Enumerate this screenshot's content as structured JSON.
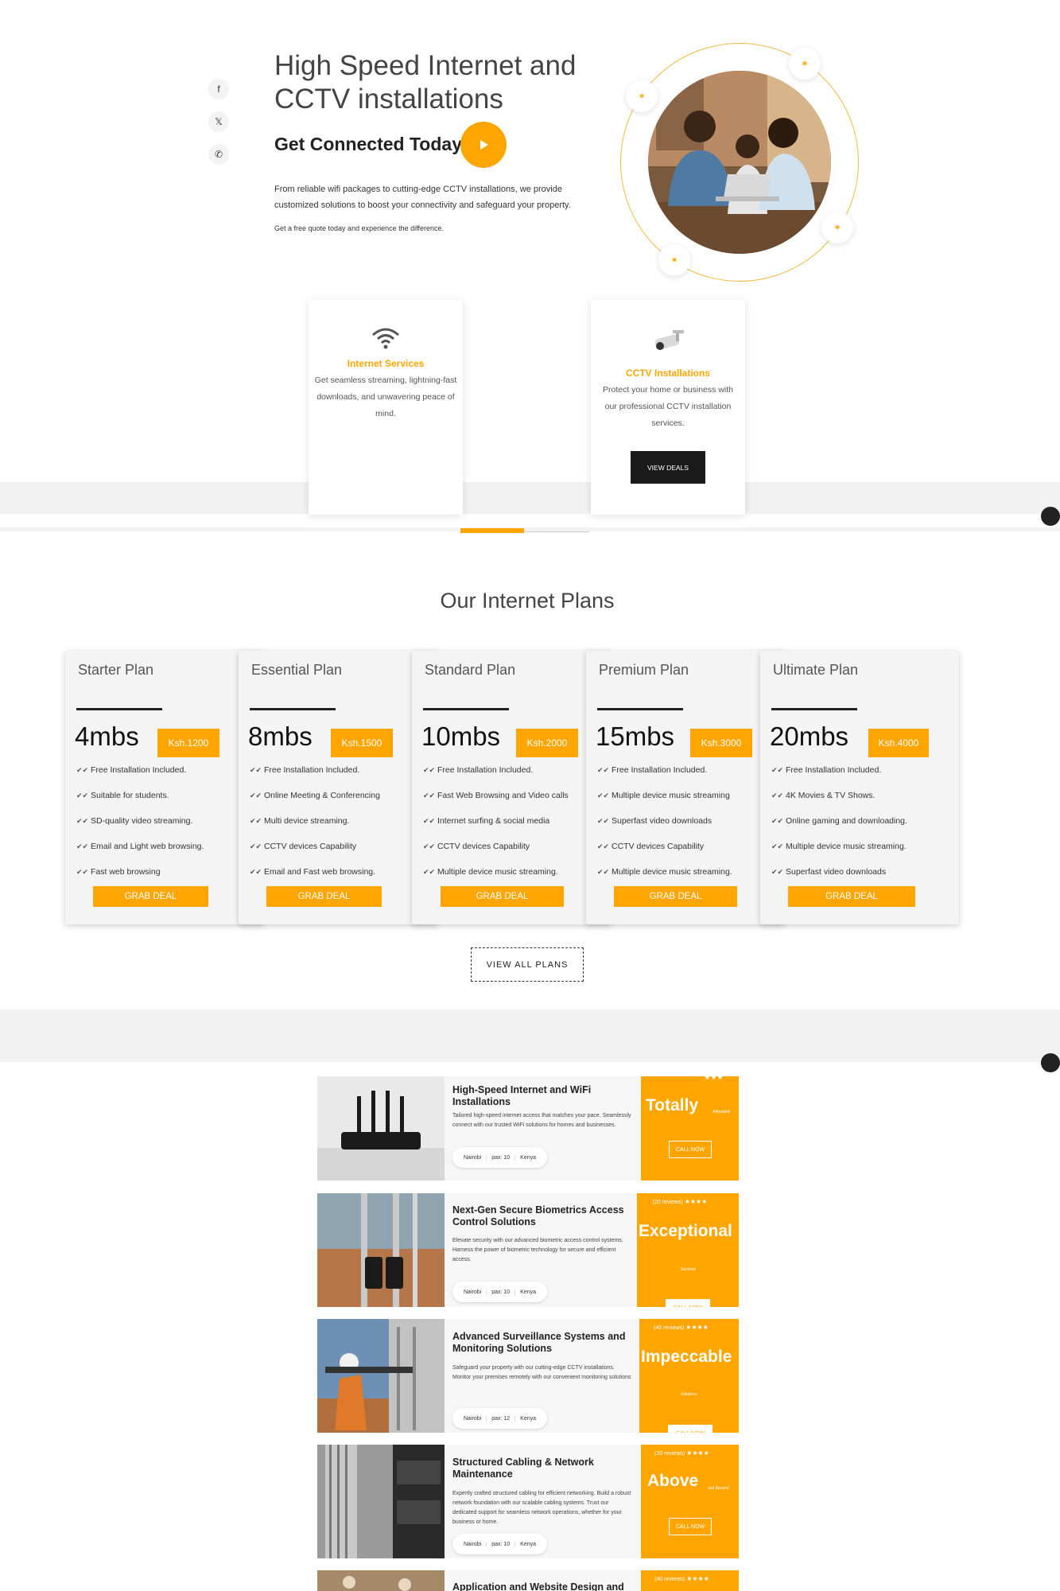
{
  "hero": {
    "title": "High Speed Internet and CCTV installations",
    "subtitle": "Get Connected Today",
    "description": "From reliable wifi packages to cutting-edge CCTV installations, we provide customized solutions to boost your connectivity and safeguard your property.",
    "note": "Get a free quote today and experience the difference."
  },
  "social": [
    {
      "icon": "facebook-icon",
      "glyph": "f"
    },
    {
      "icon": "x-icon",
      "glyph": "𝕏"
    },
    {
      "icon": "whatsapp-icon",
      "glyph": "✆"
    }
  ],
  "services": [
    {
      "title": "Internet Services",
      "text": "Get seamless streaming, lightning-fast downloads, and unwavering peace of mind.",
      "icon": "wifi-icon"
    },
    {
      "title": "CCTV Installations",
      "text": "Protect your home or business with our professional CCTV installation services.",
      "icon": "cctv-camera-icon",
      "button": "VIEW DEALS"
    }
  ],
  "plans_section": {
    "title": "Our Internet Plans",
    "view_all": "VIEW ALL PLANS",
    "plans": [
      {
        "name": "Starter Plan",
        "speed": "4mbs",
        "price": "Ksh.1200",
        "features": [
          "Free Installation Included.",
          "Suitable for students.",
          "SD-quality video streaming.",
          "Email and Light web browsing.",
          "Fast web browsing"
        ],
        "button": "GRAB DEAL"
      },
      {
        "name": "Essential Plan",
        "speed": "8mbs",
        "price": "Ksh.1500",
        "features": [
          "Free Installation Included.",
          "Online Meeting & Conferencing",
          "Multi device streaming.",
          "CCTV devices Capability",
          "Email and Fast web browsing."
        ],
        "button": "GRAB DEAL"
      },
      {
        "name": "Standard Plan",
        "speed": "10mbs",
        "price": "Ksh.2000",
        "features": [
          "Free Installation Included.",
          "Fast Web Browsing and Video calls",
          "Internet surfing & social media",
          "CCTV devices Capability",
          "Multiple device music streaming."
        ],
        "button": "GRAB DEAL"
      },
      {
        "name": "Premium Plan",
        "speed": "15mbs",
        "price": "Ksh.3000",
        "features": [
          "Free Installation Included.",
          "Multiple device music streaming",
          "Superfast video downloads",
          "CCTV devices Capability",
          "Multiple device music streaming."
        ],
        "button": "GRAB DEAL"
      },
      {
        "name": "Ultimate Plan",
        "speed": "20mbs",
        "price": "Ksh.4000",
        "features": [
          "Free Installation Included.",
          "4K Movies & TV Shows.",
          "Online gaming and downloading.",
          "Multiple device music streaming.",
          "Superfast video downloads"
        ],
        "button": "GRAB DEAL"
      }
    ]
  },
  "service_cards": [
    {
      "title": "High-Speed Internet and WiFi Installations",
      "desc": "Tailored high-speed internet access that matches your pace. Seamlessly connect with our trusted WiFi solutions for homes and businesses.",
      "tags": [
        "Nairobi",
        "pax: 10",
        "Kenya"
      ],
      "reviews": "",
      "stars": "★★★",
      "word": "Totally",
      "small": "Affordable",
      "button": "CALL NOW"
    },
    {
      "title": "Next-Gen Secure Biometrics Access Control Solutions",
      "desc": "Elevate security with our advanced biometric access control systems. Harness the power of biometric technology for secure and efficient access.",
      "tags": [
        "Nairobi",
        "pax: 10",
        "Kenya"
      ],
      "reviews": "(20 reviews)",
      "stars": "★★★★",
      "word": "Exceptional",
      "small": "Services",
      "button": "CALL NOW"
    },
    {
      "title": "Advanced Surveillance Systems and Monitoring Solutions",
      "desc": "Safeguard your property with our cutting-edge CCTV installations. Monitor your premises remotely with our convenient monitoring solutions",
      "tags": [
        "Nairobi",
        "pax: 12",
        "Kenya"
      ],
      "reviews": "(40 reviews)",
      "stars": "★★★★",
      "word": "Impeccable",
      "small": "Solutions",
      "button": "CALL NOW"
    },
    {
      "title": "Structured Cabling & Network Maintenance",
      "desc": "Expertly crafted structured cabling for efficient networking. Build a robust network foundation with our scalable cabling systems. Trust our dedicated support for seamless network operations, whether for your business or home.",
      "tags": [
        "Nairobi",
        "pax: 10",
        "Kenya"
      ],
      "reviews": "(20 reviews)",
      "stars": "★★★★",
      "word": "Above",
      "small": "and Beyond",
      "button": "CALL NOW"
    },
    {
      "title": "Application and Website Design and",
      "desc": "",
      "tags": [],
      "reviews": "(40 reviews)",
      "stars": "★★★★",
      "word": "",
      "small": "",
      "button": ""
    }
  ],
  "colors": {
    "accent": "#ffa500",
    "dark": "#1a1a1a",
    "band": "#f2f2f2"
  }
}
